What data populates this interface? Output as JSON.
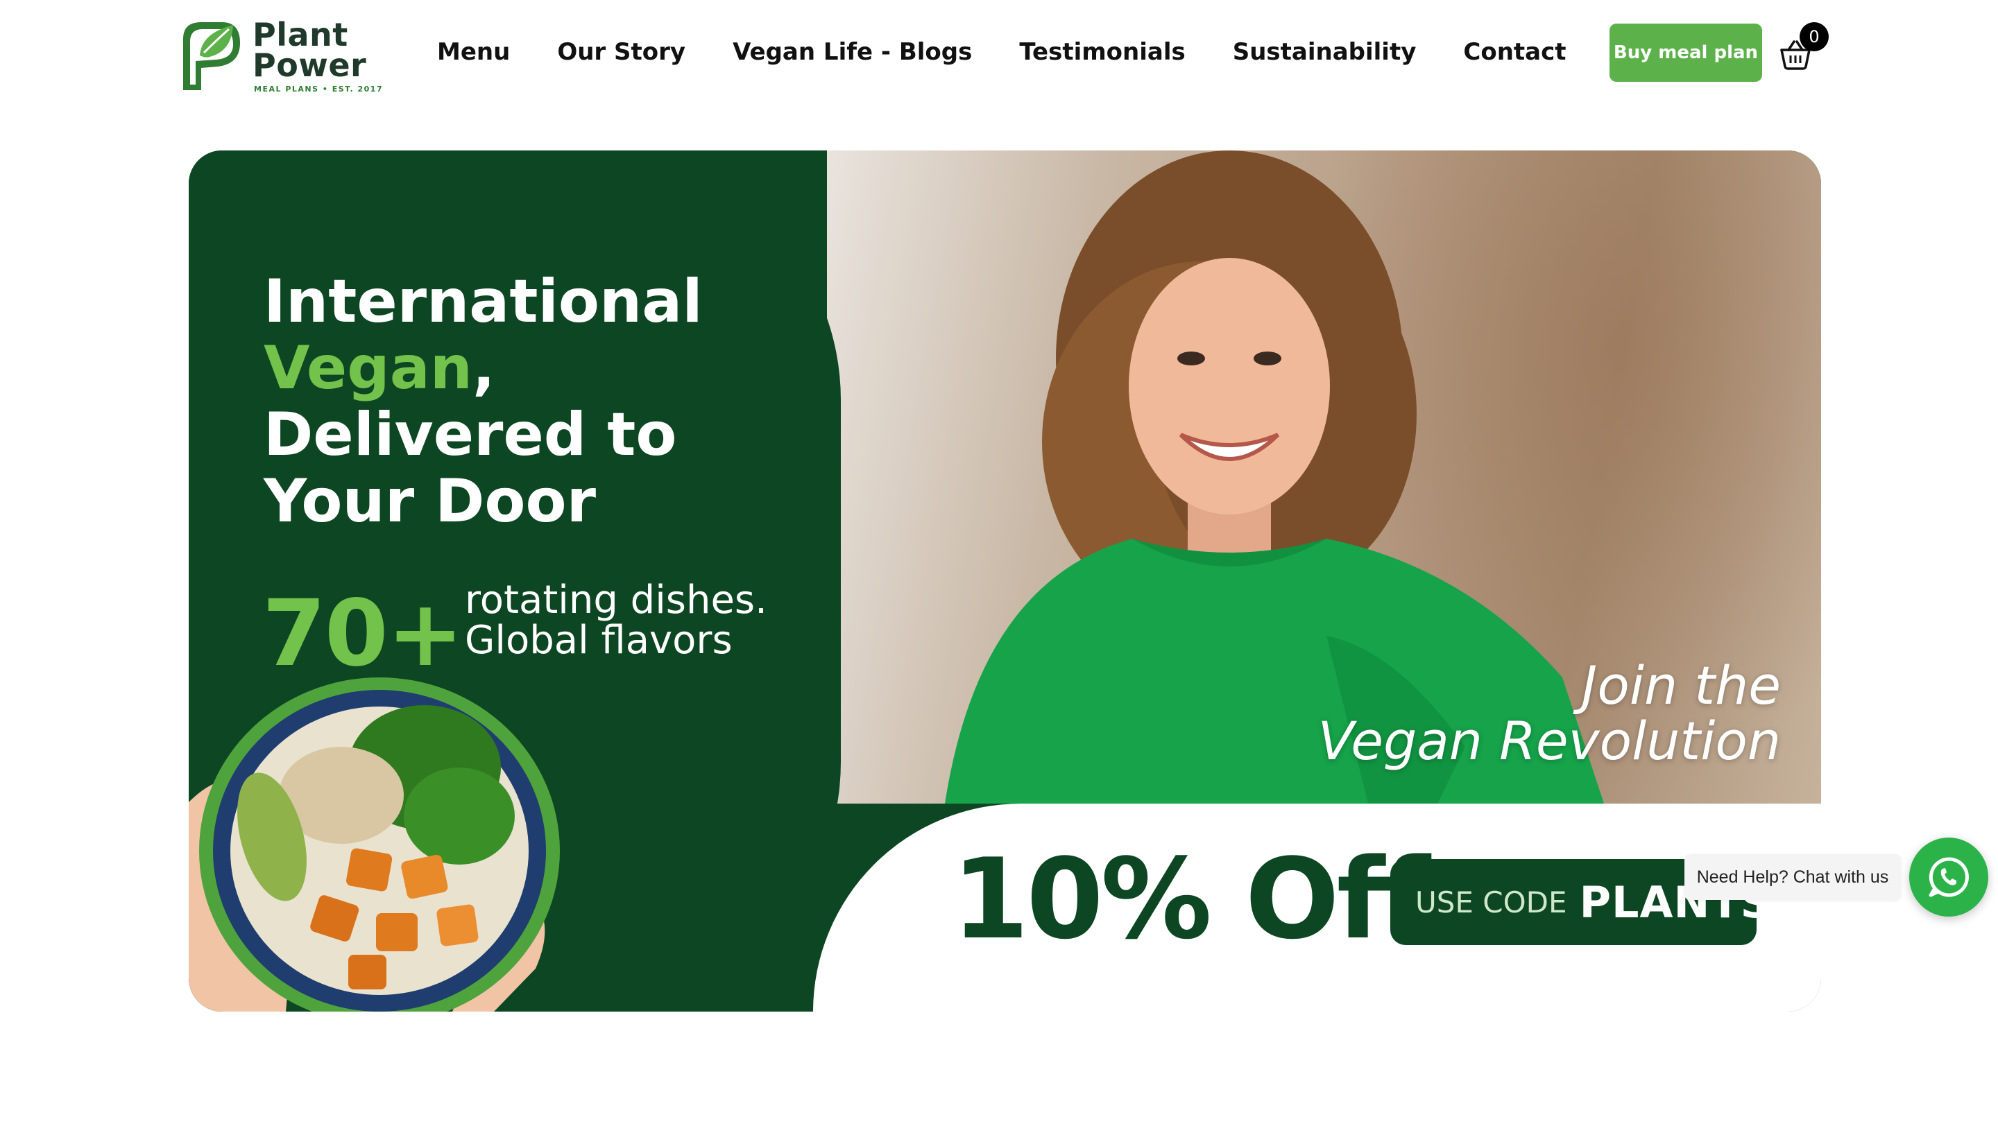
{
  "brand": {
    "name_line1": "Plant",
    "name_line2": "Power",
    "tagline": "MEAL PLANS • EST. 2017"
  },
  "nav": {
    "items": [
      {
        "label": "Menu"
      },
      {
        "label": "Our Story"
      },
      {
        "label": "Vegan Life - Blogs"
      },
      {
        "label": "Testimonials"
      },
      {
        "label": "Sustainability"
      },
      {
        "label": "Contact"
      }
    ]
  },
  "header": {
    "buy_button": "Buy meal plan",
    "cart_count": "0",
    "cart_icon": "basket-icon"
  },
  "hero": {
    "headline_line1": "International",
    "headline_line2_green": "Vegan",
    "headline_line2_rest": ",",
    "headline_line3": "Delivered to",
    "headline_line4": "Your Door",
    "count": "70+",
    "count_text_line1": "rotating dishes.",
    "count_text_line2": "Global flavors",
    "tagline_line1": "Join the",
    "tagline_line2": "Vegan Revolution",
    "offer": "10% Off",
    "code_prefix": "USE CODE",
    "code_value": "PLANTS"
  },
  "chat": {
    "label": "Need Help? Chat with us",
    "icon": "whatsapp-icon"
  },
  "colors": {
    "dark_green": "#0d4622",
    "light_green": "#73c24b",
    "button_green": "#5db14a",
    "whatsapp_green": "#2bb34a"
  }
}
